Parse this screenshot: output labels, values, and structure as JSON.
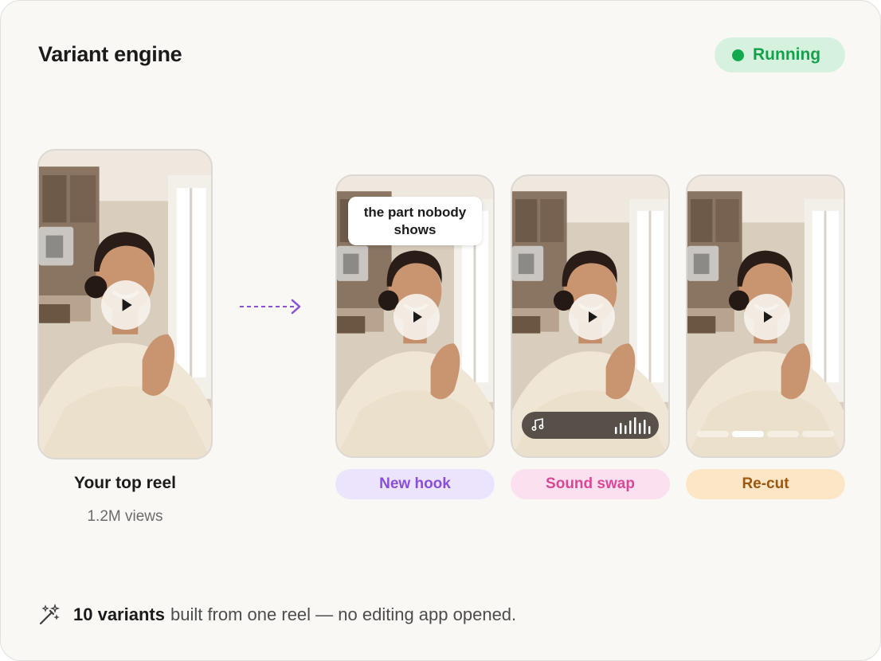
{
  "header": {
    "title": "Variant engine",
    "status": {
      "label": "Running",
      "color": "#13a94f"
    }
  },
  "source_reel": {
    "label": "Your top reel",
    "views": "1.2M views"
  },
  "variants": [
    {
      "name": "New hook",
      "overlay_text": "the part nobody shows"
    },
    {
      "name": "Sound swap"
    },
    {
      "name": "Re-cut"
    }
  ],
  "footer": {
    "icon": "magic-wand-icon",
    "count": "10 variants",
    "text": "built from one reel — no editing app opened."
  },
  "colors": {
    "new_hook": "#8a4fd8",
    "sound_swap": "#d84a96",
    "re_cut": "#9a5810",
    "arrow": "#8a4fd8"
  }
}
